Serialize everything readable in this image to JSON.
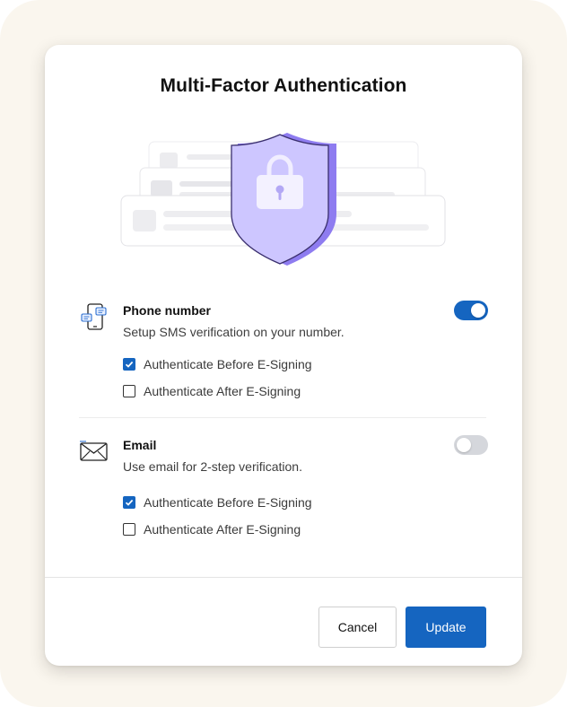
{
  "dialog": {
    "title": "Multi-Factor Authentication"
  },
  "sections": [
    {
      "icon": "phone-sms-icon",
      "title": "Phone number",
      "description": "Setup SMS verification on your number.",
      "enabled": true,
      "options": [
        {
          "label": "Authenticate Before E-Signing",
          "checked": true
        },
        {
          "label": "Authenticate After E-Signing",
          "checked": false
        }
      ]
    },
    {
      "icon": "email-envelope-icon",
      "title": "Email",
      "description": "Use email for 2-step verification.",
      "enabled": false,
      "options": [
        {
          "label": "Authenticate Before E-Signing",
          "checked": true
        },
        {
          "label": "Authenticate After E-Signing",
          "checked": false
        }
      ]
    }
  ],
  "footer": {
    "cancel_label": "Cancel",
    "update_label": "Update"
  },
  "colors": {
    "accent": "#1565c0",
    "backdrop": "#faf6ee",
    "shield": "#c9c3ff"
  }
}
